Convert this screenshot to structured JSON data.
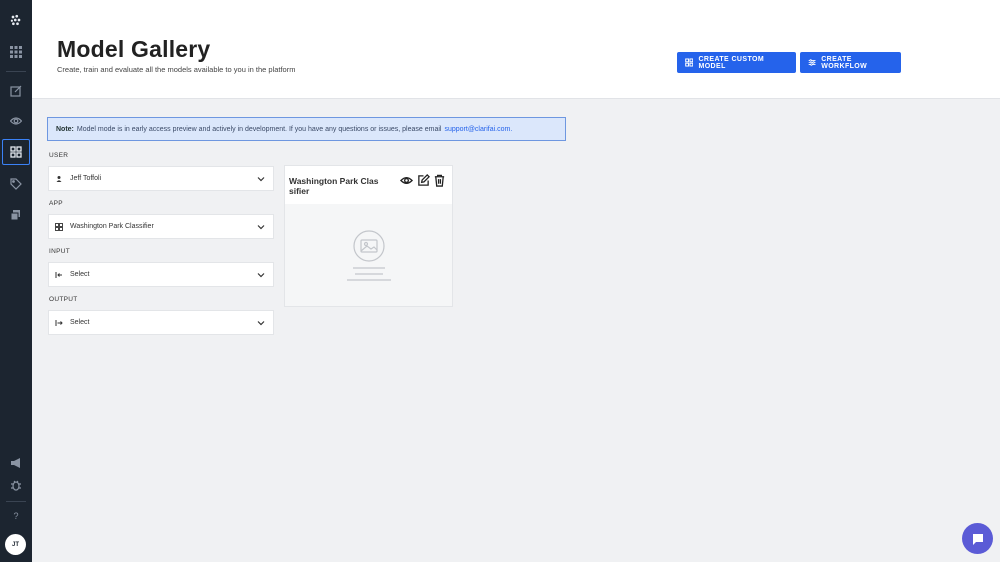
{
  "header": {
    "title": "Model Gallery",
    "subtitle": "Create, train and evaluate all the models available to you in the platform",
    "create_custom_model": "CREATE CUSTOM MODEL",
    "create_workflow": "CREATE WORKFLOW"
  },
  "note": {
    "prefix": "Note:",
    "text": "Model mode is in early access preview and actively in development. If you have any questions or issues, please email",
    "email": "support@clarifai.com."
  },
  "filters": {
    "user": {
      "label": "USER",
      "value": "Jeff Toffoli"
    },
    "app": {
      "label": "APP",
      "value": "Washington Park Classifier"
    },
    "input": {
      "label": "INPUT",
      "value": "Select"
    },
    "output": {
      "label": "OUTPUT",
      "value": "Select"
    }
  },
  "card": {
    "title": "Washington Park Classifier"
  },
  "sidebar": {
    "avatar_initials": "JT",
    "help": "?",
    "icons": [
      "logo-icon",
      "apps-grid-icon",
      "edit-icon",
      "eye-icon",
      "model-gallery-icon",
      "tag-icon",
      "stack-icon",
      "megaphone-icon",
      "bug-icon",
      "help-icon"
    ]
  },
  "colors": {
    "sidebar": "#1c2530",
    "accent": "#2563eb",
    "note_bg": "#dbe7fb",
    "chat": "#5b5bd6"
  }
}
